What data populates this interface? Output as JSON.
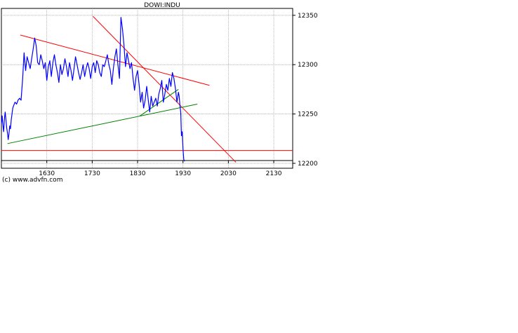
{
  "chart_data": {
    "type": "line",
    "title": "DOWI:INDU",
    "xlabel": "",
    "ylabel": "",
    "x_tick_labels": [
      "1630",
      "1730",
      "1830",
      "1930",
      "2030",
      "2130"
    ],
    "x_ticks_minutes": [
      990,
      1050,
      1110,
      1170,
      1230,
      1290
    ],
    "y_tick_labels": [
      "12350",
      "12300",
      "12250",
      "12200"
    ],
    "y_ticks": [
      12350,
      12300,
      12250,
      12200
    ],
    "xlim_minutes": [
      930,
      1315
    ],
    "ylim": [
      12195,
      12357
    ],
    "grid": true,
    "series": [
      {
        "color": "#0000ff",
        "x_minutes": [
          930,
          931,
          932,
          933,
          934,
          935,
          936,
          937,
          938,
          939,
          940,
          941,
          942,
          943,
          944,
          945,
          946,
          948,
          950,
          952,
          954,
          956,
          958,
          960,
          962,
          964,
          966,
          968,
          970,
          972,
          974,
          976,
          978,
          980,
          982,
          984,
          986,
          988,
          990,
          992,
          994,
          996,
          998,
          1000,
          1002,
          1004,
          1006,
          1008,
          1010,
          1012,
          1014,
          1016,
          1018,
          1020,
          1022,
          1024,
          1026,
          1028,
          1030,
          1032,
          1034,
          1036,
          1038,
          1040,
          1042,
          1044,
          1046,
          1048,
          1050,
          1052,
          1054,
          1056,
          1058,
          1060,
          1062,
          1064,
          1066,
          1068,
          1070,
          1072,
          1074,
          1076,
          1078,
          1080,
          1082,
          1084,
          1086,
          1088,
          1090,
          1092,
          1094,
          1096,
          1098,
          1100,
          1102,
          1104,
          1106,
          1108,
          1110,
          1112,
          1114,
          1116,
          1118,
          1120,
          1122,
          1124,
          1126,
          1128,
          1130,
          1132,
          1134,
          1136,
          1138,
          1140,
          1142,
          1144,
          1146,
          1148,
          1150,
          1152,
          1154,
          1156,
          1158,
          1160,
          1162,
          1164,
          1165,
          1166,
          1167,
          1168,
          1169,
          1170,
          1171,
          1172
        ],
        "values": [
          12240,
          12248,
          12238,
          12232,
          12245,
          12252,
          12244,
          12236,
          12231,
          12224,
          12230,
          12238,
          12235,
          12244,
          12250,
          12256,
          12258,
          12262,
          12260,
          12264,
          12266,
          12264,
          12285,
          12312,
          12294,
          12308,
          12302,
          12296,
          12306,
          12316,
          12327,
          12319,
          12302,
          12300,
          12310,
          12304,
          12296,
          12302,
          12284,
          12298,
          12304,
          12288,
          12302,
          12310,
          12300,
          12292,
          12282,
          12300,
          12290,
          12296,
          12306,
          12298,
          12288,
          12302,
          12294,
          12284,
          12296,
          12308,
          12300,
          12292,
          12285,
          12292,
          12300,
          12288,
          12296,
          12302,
          12296,
          12286,
          12298,
          12302,
          12292,
          12304,
          12300,
          12292,
          12288,
          12300,
          12298,
          12304,
          12310,
          12300,
          12294,
          12280,
          12296,
          12308,
          12316,
          12300,
          12286,
          12348,
          12336,
          12320,
          12298,
          12312,
          12304,
          12296,
          12302,
          12286,
          12274,
          12288,
          12294,
          12280,
          12262,
          12272,
          12256,
          12264,
          12278,
          12265,
          12252,
          12268,
          12258,
          12262,
          12266,
          12258,
          12270,
          12276,
          12284,
          12262,
          12270,
          12280,
          12274,
          12286,
          12278,
          12292,
          12286,
          12276,
          12262,
          12272,
          12268,
          12258,
          12252,
          12228,
          12232,
          12215,
          12204,
          12202,
          12214,
          12204,
          12218,
          12216
        ]
      }
    ],
    "trendlines": [
      {
        "color": "#ff0000",
        "x_minutes": [
          955,
          1205
        ],
        "values": [
          12330,
          12279
        ]
      },
      {
        "color": "#ff0000",
        "x_minutes": [
          1051,
          1240
        ],
        "values": [
          12349,
          12201
        ]
      },
      {
        "color": "#ff0000",
        "x_minutes": [
          930,
          1315
        ],
        "values": [
          12213,
          12213
        ]
      },
      {
        "color": "#008000",
        "x_minutes": [
          938,
          1189
        ],
        "values": [
          12220,
          12260
        ]
      },
      {
        "color": "#008000",
        "x_minutes": [
          1113,
          1164
        ],
        "values": [
          12248,
          12275
        ]
      }
    ],
    "copyright": "(c) www.advfn.com"
  }
}
